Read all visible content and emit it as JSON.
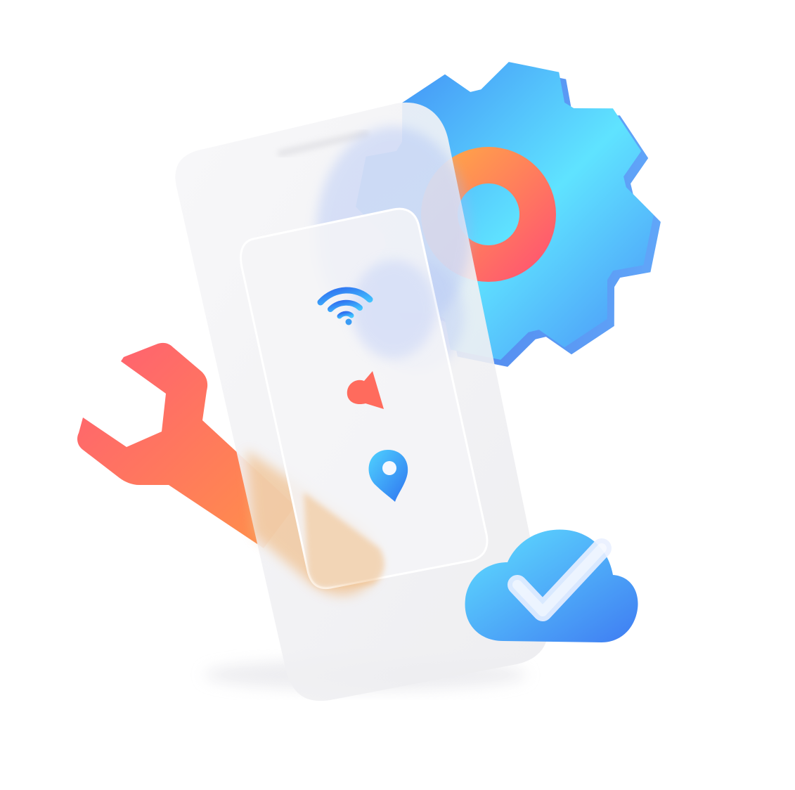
{
  "illustration": {
    "icons": [
      "gear-icon",
      "wrench-icon",
      "phone-icon",
      "wifi-icon",
      "megaphone-icon",
      "location-pin-icon",
      "cloud-check-icon"
    ],
    "colors": {
      "background": "#ffffff",
      "gear_light": "#5fe3ff",
      "gear_dark": "#3f86f5",
      "ring_orange": "#ffa24a",
      "ring_red": "#ff5a6e",
      "wrench_red": "#ff5e73",
      "wrench_orange": "#ff9248",
      "glass_panel": "#f1f1f3",
      "wifi_blue": "#2f7ef6",
      "megaphone_coral": "#ff6b5d",
      "pin_blue": "#2b9cf5",
      "cloud_cyan": "#5fe0ff",
      "cloud_blue": "#3f7cf2"
    }
  }
}
